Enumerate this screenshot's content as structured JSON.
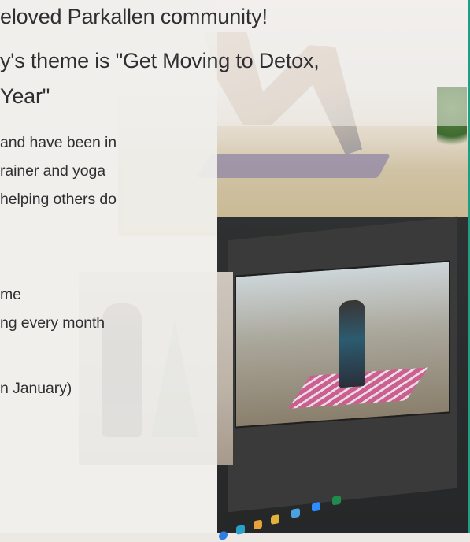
{
  "flyer": {
    "heading_lines": [
      "eloved Parkallen community!",
      "y's theme is \"Get Moving to Detox,",
      " Year\""
    ],
    "intro_lines": [
      " and have been in",
      "rainer and yoga",
      " helping others do"
    ],
    "detail_lines": [
      "me",
      "ng every month",
      "n January)"
    ]
  },
  "colors": {
    "accent_border": "#1f9e83",
    "text": "#2f2f31"
  },
  "icons": [
    "chrome-icon",
    "app-icon",
    "files-icon",
    "store-icon",
    "mail-icon",
    "zoom-icon",
    "excel-icon"
  ]
}
